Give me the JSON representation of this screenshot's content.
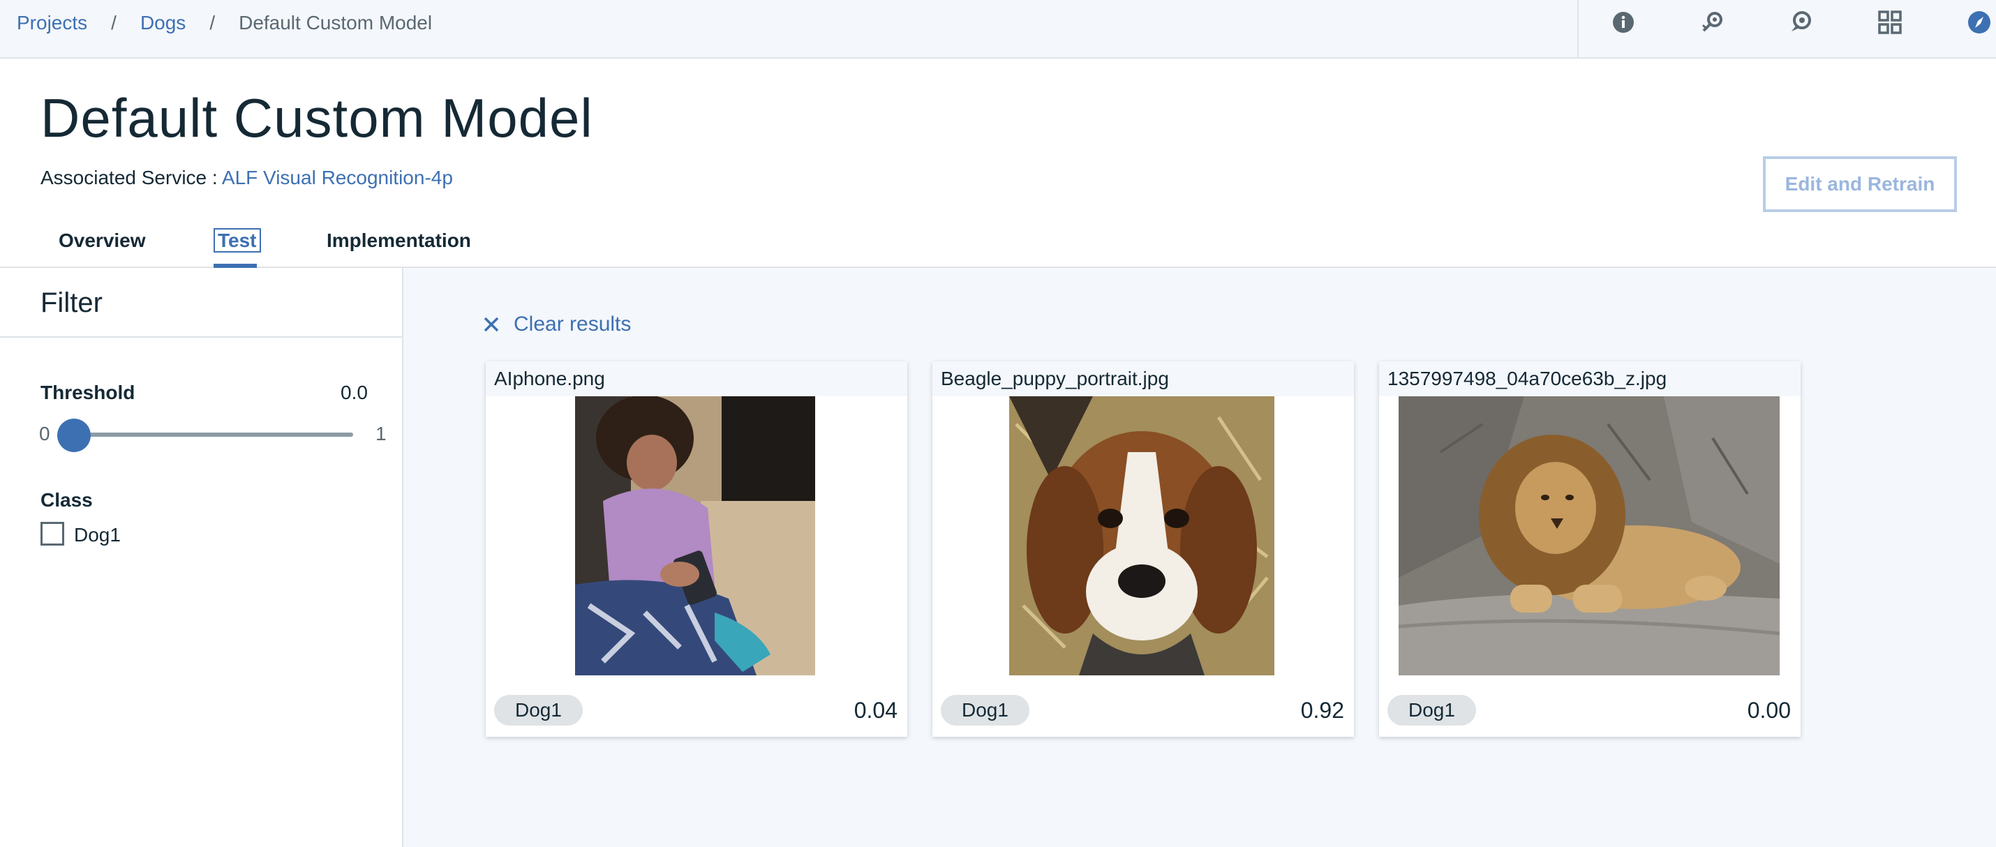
{
  "breadcrumb": {
    "items": [
      "Projects",
      "Dogs"
    ],
    "current": "Default Custom Model",
    "separator": "/"
  },
  "toolbar": {
    "icons": [
      "info-icon",
      "search-key-icon",
      "chat-icon",
      "apps-grid-icon",
      "compass-icon"
    ]
  },
  "header": {
    "title": "Default Custom Model",
    "service_label": "Associated Service :",
    "service_name": "ALF Visual Recognition-4p",
    "retrain_label": "Edit and Retrain"
  },
  "tabs": [
    "Overview",
    "Test",
    "Implementation"
  ],
  "active_tab": "Test",
  "filter": {
    "title": "Filter",
    "threshold_label": "Threshold",
    "threshold_value": "0.0",
    "threshold_level": 0.0,
    "slider_min": "0",
    "slider_max": "1",
    "class_label": "Class",
    "class_options": [
      {
        "label": "Dog1",
        "checked": false
      }
    ]
  },
  "results": {
    "clear_label": "Clear results",
    "cards": [
      {
        "filename": "AIphone.png",
        "tag": "Dog1",
        "score": "0.04"
      },
      {
        "filename": "Beagle_puppy_portrait.jpg",
        "tag": "Dog1",
        "score": "0.92"
      },
      {
        "filename": "1357997498_04a70ce63b_z.jpg",
        "tag": "Dog1",
        "score": "0.00"
      }
    ]
  },
  "colors": {
    "accent": "#3d70b2",
    "text": "#152935",
    "muted": "#5a6872",
    "border": "#dfe3e6",
    "background": "#f4f7fb"
  }
}
